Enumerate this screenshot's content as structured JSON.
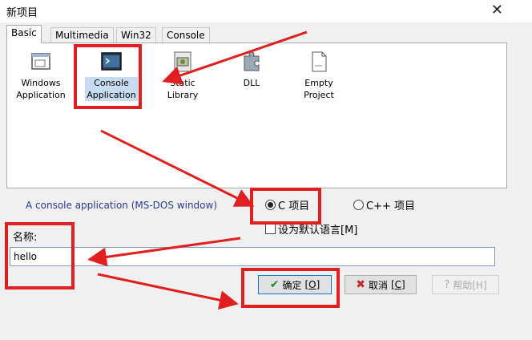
{
  "window": {
    "title": "新项目",
    "close_glyph": "✕"
  },
  "tabs": [
    {
      "label": "Basic",
      "active": true
    },
    {
      "label": "Multimedia",
      "active": false
    },
    {
      "label": "Win32",
      "active": false
    },
    {
      "label": "Console",
      "active": false
    }
  ],
  "templates": [
    {
      "label_line1": "Windows",
      "label_line2": "Application",
      "icon": "window-app-icon"
    },
    {
      "label_line1": "Console",
      "label_line2": "Application",
      "icon": "console-app-icon",
      "selected": true
    },
    {
      "label_line1": "Static Library",
      "label_line2": "",
      "icon": "static-library-icon"
    },
    {
      "label_line1": "DLL",
      "label_line2": "",
      "icon": "dll-icon"
    },
    {
      "label_line1": "Empty Project",
      "label_line2": "",
      "icon": "empty-project-icon"
    }
  ],
  "description": "A console application (MS-DOS window)",
  "language": {
    "c_label": "C 项目",
    "cpp_label": "C++ 项目",
    "selected": "C"
  },
  "default_lang_label": "设为默认语言[M]",
  "name": {
    "label": "名称:",
    "value": "hello"
  },
  "buttons": {
    "ok_label": "确定",
    "ok_key": "[O]",
    "cancel_label": "取消",
    "cancel_key": "[C]",
    "help_label": "帮助[H]"
  },
  "colors": {
    "annotation": "#e02020",
    "description_text": "#2b3a90"
  }
}
